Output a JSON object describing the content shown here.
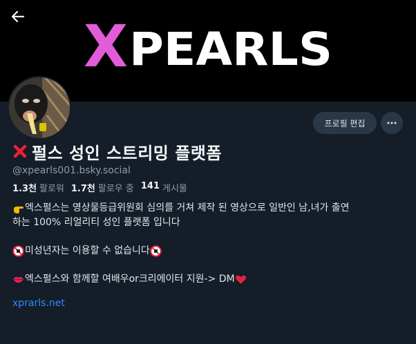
{
  "banner": {
    "logo_text": "XPEARLS",
    "logo_colors": [
      "#e25bd9",
      "#ffffff"
    ]
  },
  "icons": {
    "back": "arrow-left-icon",
    "more": "ellipsis-icon",
    "name_prefix": "red-cross-mark-icon"
  },
  "toolbar": {
    "edit_label": "프로필 편집"
  },
  "profile": {
    "display_name": "펄스 성인 스트리밍 플랫폼",
    "handle": "@xpearls001.bsky.social"
  },
  "stats": {
    "followers_count": "1.3천",
    "followers_label": "팔로워",
    "following_count": "1.7천",
    "following_label": "팔로우 중",
    "posts_count": "141",
    "posts_label": "게시물"
  },
  "bio": {
    "line1": "엑스펄스는 영상물등급위원회 심의를 거쳐 제작 된 영상으로 일반인 남,녀가 출연",
    "line2": "하는 100% 리얼리티 성인 플랫폼 입니다",
    "line3": "미성년자는 이용할 수 없습니다",
    "line4": "엑스펄스와 함께할 여배우or크리에이터 지원-> DM"
  },
  "link": "xprarls.net",
  "colors": {
    "background": "#151d28",
    "banner": "#000000",
    "link": "#2f8bff",
    "button": "#2a3746"
  }
}
